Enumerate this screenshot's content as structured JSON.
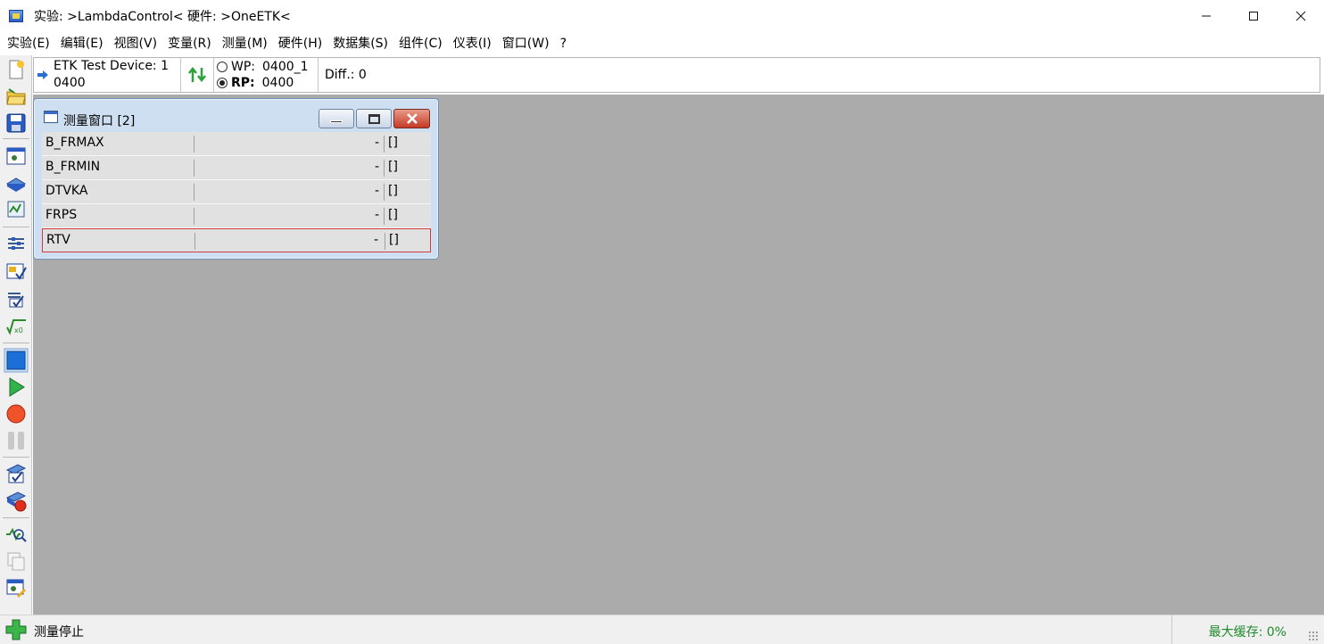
{
  "window": {
    "title": "实验: >LambdaControl< 硬件: >OneETK<",
    "controls": {
      "minimize": "—",
      "maximize": "☐",
      "close": "✕"
    }
  },
  "menu": [
    {
      "label": "实验(E)"
    },
    {
      "label": "编辑(E)"
    },
    {
      "label": "视图(V)"
    },
    {
      "label": "变量(R)"
    },
    {
      "label": "测量(M)"
    },
    {
      "label": "硬件(H)"
    },
    {
      "label": "数据集(S)"
    },
    {
      "label": "组件(C)"
    },
    {
      "label": "仪表(I)"
    },
    {
      "label": "窗口(W)"
    },
    {
      "label": "?"
    }
  ],
  "left_toolbar": {
    "icons": [
      "new-experiment-icon",
      "open-folder-icon",
      "save-icon",
      "experiment-window-icon",
      "hardware-module-icon",
      "dataset-icon",
      "variable-list-icon",
      "measurement-config-icon",
      "calibration-config-icon",
      "formula-icon",
      "stop-square-icon",
      "start-measurement-icon",
      "record-icon",
      "pause-icon",
      "checklist-icon",
      "record-device-icon",
      "signal-search-icon",
      "copy-icon",
      "edit-window-icon"
    ]
  },
  "device_bar": {
    "device_line1": "ETK Test Device: 1",
    "device_line2": "0400",
    "wp_label": "WP:",
    "wp_value": "0400_1",
    "rp_label": "RP:",
    "rp_value": "0400",
    "diff_text": "Diff.: 0"
  },
  "measure_window": {
    "title": "测量窗口 [2]",
    "rows": [
      {
        "name": "B_FRMAX",
        "value": "-",
        "unit": "[]"
      },
      {
        "name": "B_FRMIN",
        "value": "-",
        "unit": "[]"
      },
      {
        "name": "DTVKA",
        "value": "-",
        "unit": "[]"
      },
      {
        "name": "FRPS",
        "value": "-",
        "unit": "[]"
      },
      {
        "name": "RTV",
        "value": "-",
        "unit": "[]"
      }
    ]
  },
  "status": {
    "text": "测量停止",
    "cache": "最大缓存: 0%"
  }
}
